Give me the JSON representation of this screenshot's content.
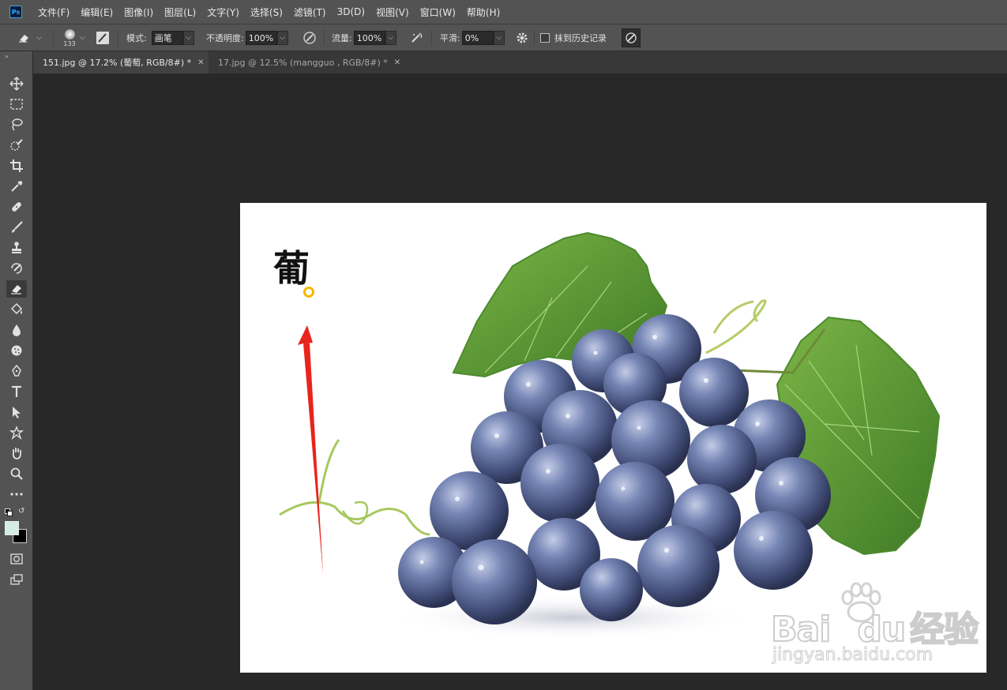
{
  "app": {
    "logo_text": "Ps"
  },
  "menubar": {
    "items": [
      "文件(F)",
      "编辑(E)",
      "图像(I)",
      "图层(L)",
      "文字(Y)",
      "选择(S)",
      "滤镜(T)",
      "3D(D)",
      "视图(V)",
      "窗口(W)",
      "帮助(H)"
    ]
  },
  "options": {
    "brush_size": "133",
    "mode_label": "模式:",
    "mode_value": "画笔",
    "opacity_label": "不透明度:",
    "opacity_value": "100%",
    "flow_label": "流量:",
    "flow_value": "100%",
    "smoothing_label": "平滑:",
    "smoothing_value": "0%",
    "erase_history_label": "抹到历史记录",
    "erase_history_checked": false
  },
  "tabs": [
    {
      "label": "151.jpg @ 17.2% (葡萄, RGB/8#) *",
      "active": true
    },
    {
      "label": "17.jpg @ 12.5% (mangguo , RGB/8#) *",
      "active": false
    }
  ],
  "toolbar": {
    "tools": [
      "move-tool",
      "marquee-tool",
      "lasso-tool",
      "quick-select-tool",
      "crop-tool",
      "eyedropper-tool",
      "healing-tool",
      "brush-tool",
      "stamp-tool",
      "history-brush-tool",
      "eraser-tool",
      "paint-bucket-tool",
      "blur-tool",
      "dodge-tool",
      "pen-tool",
      "type-tool",
      "path-select-tool",
      "shape-tool",
      "hand-tool",
      "zoom-tool",
      "more-tools"
    ],
    "active_tool": "eraser-tool",
    "foreground_color": "#d4ece4",
    "background_color": "#000000"
  },
  "canvas": {
    "text_layer": "葡",
    "watermark": {
      "brand": "Bai",
      "brand_end": "du",
      "brand_cn": "经验",
      "url": "jingyan.baidu.com"
    }
  },
  "colors": {
    "annotation_arrow": "#e8241c",
    "brush_cursor": "#f5b800",
    "grape": "#5a6a9a",
    "leaf": "#5e9a35"
  }
}
